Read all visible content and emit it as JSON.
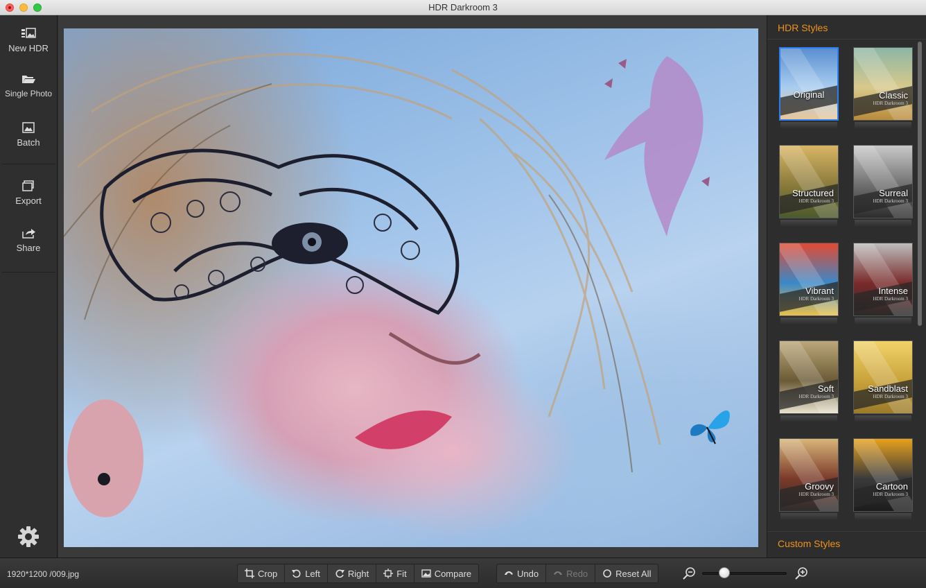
{
  "window": {
    "title": "HDR Darkroom 3"
  },
  "sidebar": {
    "items": [
      {
        "label": "New HDR",
        "icon": "new-hdr-icon"
      },
      {
        "label": "Single Photo",
        "icon": "folder-open-icon"
      },
      {
        "label": "Batch",
        "icon": "batch-icon"
      },
      {
        "label": "Export",
        "icon": "export-icon"
      },
      {
        "label": "Share",
        "icon": "share-icon"
      }
    ],
    "settings_icon": "gear-icon"
  },
  "panel": {
    "title": "HDR Styles",
    "custom_title": "Custom Styles",
    "watermark": "HDR Darkroom 3",
    "styles": [
      {
        "name": "Original",
        "selected": true,
        "colors": [
          "#5a8fd0",
          "#a9cdf0",
          "#e7c79a"
        ]
      },
      {
        "name": "Classic",
        "selected": false,
        "colors": [
          "#8db6a6",
          "#d8c98b",
          "#b98b3b"
        ]
      },
      {
        "name": "Structured",
        "selected": false,
        "colors": [
          "#d9b665",
          "#8a7a3c",
          "#4b5a2c"
        ]
      },
      {
        "name": "Surreal",
        "selected": false,
        "colors": [
          "#c9c9c9",
          "#6f6f6f",
          "#2d2d2d"
        ]
      },
      {
        "name": "Vibrant",
        "selected": false,
        "colors": [
          "#e24a32",
          "#3a88c9",
          "#e9c04d"
        ]
      },
      {
        "name": "Intense",
        "selected": false,
        "colors": [
          "#bdbdbd",
          "#7a2a2a",
          "#2a2a2a"
        ]
      },
      {
        "name": "Soft",
        "selected": false,
        "colors": [
          "#bca879",
          "#6b5a36",
          "#e8e2cf"
        ]
      },
      {
        "name": "Sandblast",
        "selected": false,
        "colors": [
          "#f1d36a",
          "#c9a23b",
          "#9b7a2a"
        ]
      },
      {
        "name": "Groovy",
        "selected": false,
        "colors": [
          "#d8b579",
          "#7b3a2a",
          "#2d2d2d"
        ]
      },
      {
        "name": "Cartoon",
        "selected": false,
        "colors": [
          "#e8a11c",
          "#3a3a3a",
          "#1c1c1c"
        ]
      }
    ]
  },
  "statusbar": {
    "info": "1920*1200 /009.jpg"
  },
  "toolbar": {
    "crop": "Crop",
    "left": "Left",
    "right": "Right",
    "fit": "Fit",
    "compare": "Compare",
    "undo": "Undo",
    "redo": "Redo",
    "reset_all": "Reset All"
  },
  "zoom": {
    "level": 0.26
  },
  "colors": {
    "accent": "#f0921c",
    "selection": "#2d7ff0"
  }
}
